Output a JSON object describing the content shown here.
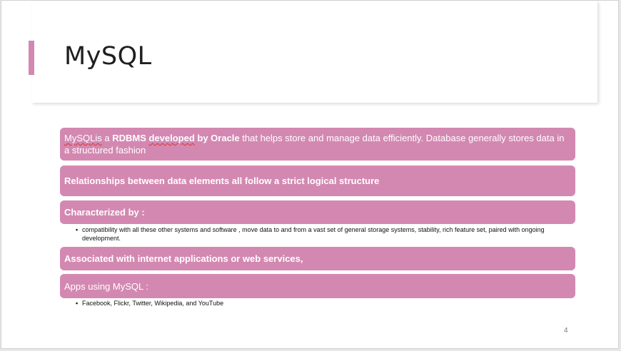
{
  "slide": {
    "title": "MySQL",
    "page_number": "4",
    "accent_color": "#d388b1"
  },
  "boxes": [
    {
      "segments": [
        {
          "text": "MySQLis",
          "style": "spell"
        },
        {
          "text": " a ",
          "style": "normal"
        },
        {
          "text": "RDBMS ",
          "style": "bold"
        },
        {
          "text": "developed",
          "style": "bold-spell"
        },
        {
          "text": " by Oracle",
          "style": "bold"
        },
        {
          "text": " that helps store and manage data efficiently. Database generally stores data in a structured fashion",
          "style": "normal"
        }
      ]
    },
    {
      "text": "Relationships between data elements all follow a strict logical structure"
    },
    {
      "text": "Characterized by :"
    },
    {
      "text": "Associated with internet applications or web services,"
    },
    {
      "text": "Apps using MySQL :"
    }
  ],
  "bullets": [
    "compatibility with all these other systems and software , move data to and from a vast set of general storage systems,  stability, rich feature set, paired with ongoing development.",
    "Facebook, Flickr, Twitter, Wikipedia, and YouTube"
  ],
  "bullet_symbol": "•"
}
